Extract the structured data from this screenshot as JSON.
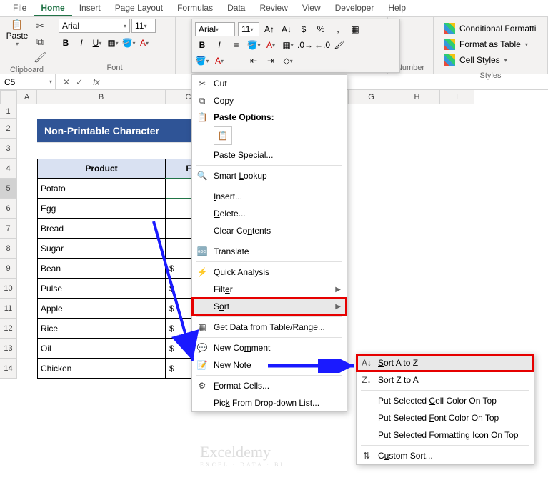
{
  "tabs": [
    "File",
    "Home",
    "Insert",
    "Page Layout",
    "Formulas",
    "Data",
    "Review",
    "View",
    "Developer",
    "Help"
  ],
  "active_tab": "Home",
  "groups": {
    "clipboard": "Clipboard",
    "font": "Font",
    "number": "Number",
    "styles": "Styles"
  },
  "clipboard": {
    "paste": "Paste"
  },
  "font": {
    "name": "Arial",
    "size": "11"
  },
  "mini": {
    "font": "Arial",
    "size": "11",
    "percent": "%",
    "dollar": "$",
    "comma": ","
  },
  "styles": {
    "cond": "Conditional Formatti",
    "table": "Format as Table",
    "cell": "Cell Styles"
  },
  "namebox": "C5",
  "col_widths": {
    "A": 28,
    "B": 180,
    "C": 64,
    "D": 64,
    "E": 64,
    "F": 64,
    "G": 64,
    "H": 64,
    "I": 48
  },
  "row_heights": {
    "1": 20,
    "default": 28
  },
  "cols": [
    "A",
    "B",
    "C",
    "D",
    "E",
    "F",
    "G",
    "H",
    "I"
  ],
  "rows": [
    1,
    2,
    3,
    4,
    5,
    6,
    7,
    8,
    9,
    10,
    11,
    12,
    13,
    14
  ],
  "title": "Non-Printable Character",
  "headers": {
    "product": "Product",
    "col2_partial": "F"
  },
  "products": [
    "Potato",
    "Egg",
    "Bread",
    "Sugar",
    "Bean",
    "Pulse",
    "Apple",
    "Rice",
    "Oil",
    "Chicken"
  ],
  "dollar": "$",
  "ctx": {
    "cut": "Cut",
    "copy": "Copy",
    "paste_opts": "Paste Options:",
    "paste_special": "Paste Special...",
    "smart": "Smart Lookup",
    "insert": "Insert...",
    "delete": "Delete...",
    "clear": "Clear Contents",
    "translate": "Translate",
    "quick": "Quick Analysis",
    "filter": "Filter",
    "sort": "Sort",
    "get_data": "Get Data from Table/Range...",
    "comment": "New Comment",
    "note": "New Note",
    "format": "Format Cells...",
    "pick": "Pick From Drop-down List..."
  },
  "sort_sub": {
    "az": "Sort A to Z",
    "za": "Sort Z to A",
    "cell_color": "Put Selected Cell Color On Top",
    "font_color": "Put Selected Font Color On Top",
    "icon": "Put Selected Formatting Icon On Top",
    "custom": "Custom Sort..."
  },
  "watermark": {
    "name": "Exceldemy",
    "tag": "EXCEL · DATA · BI"
  }
}
